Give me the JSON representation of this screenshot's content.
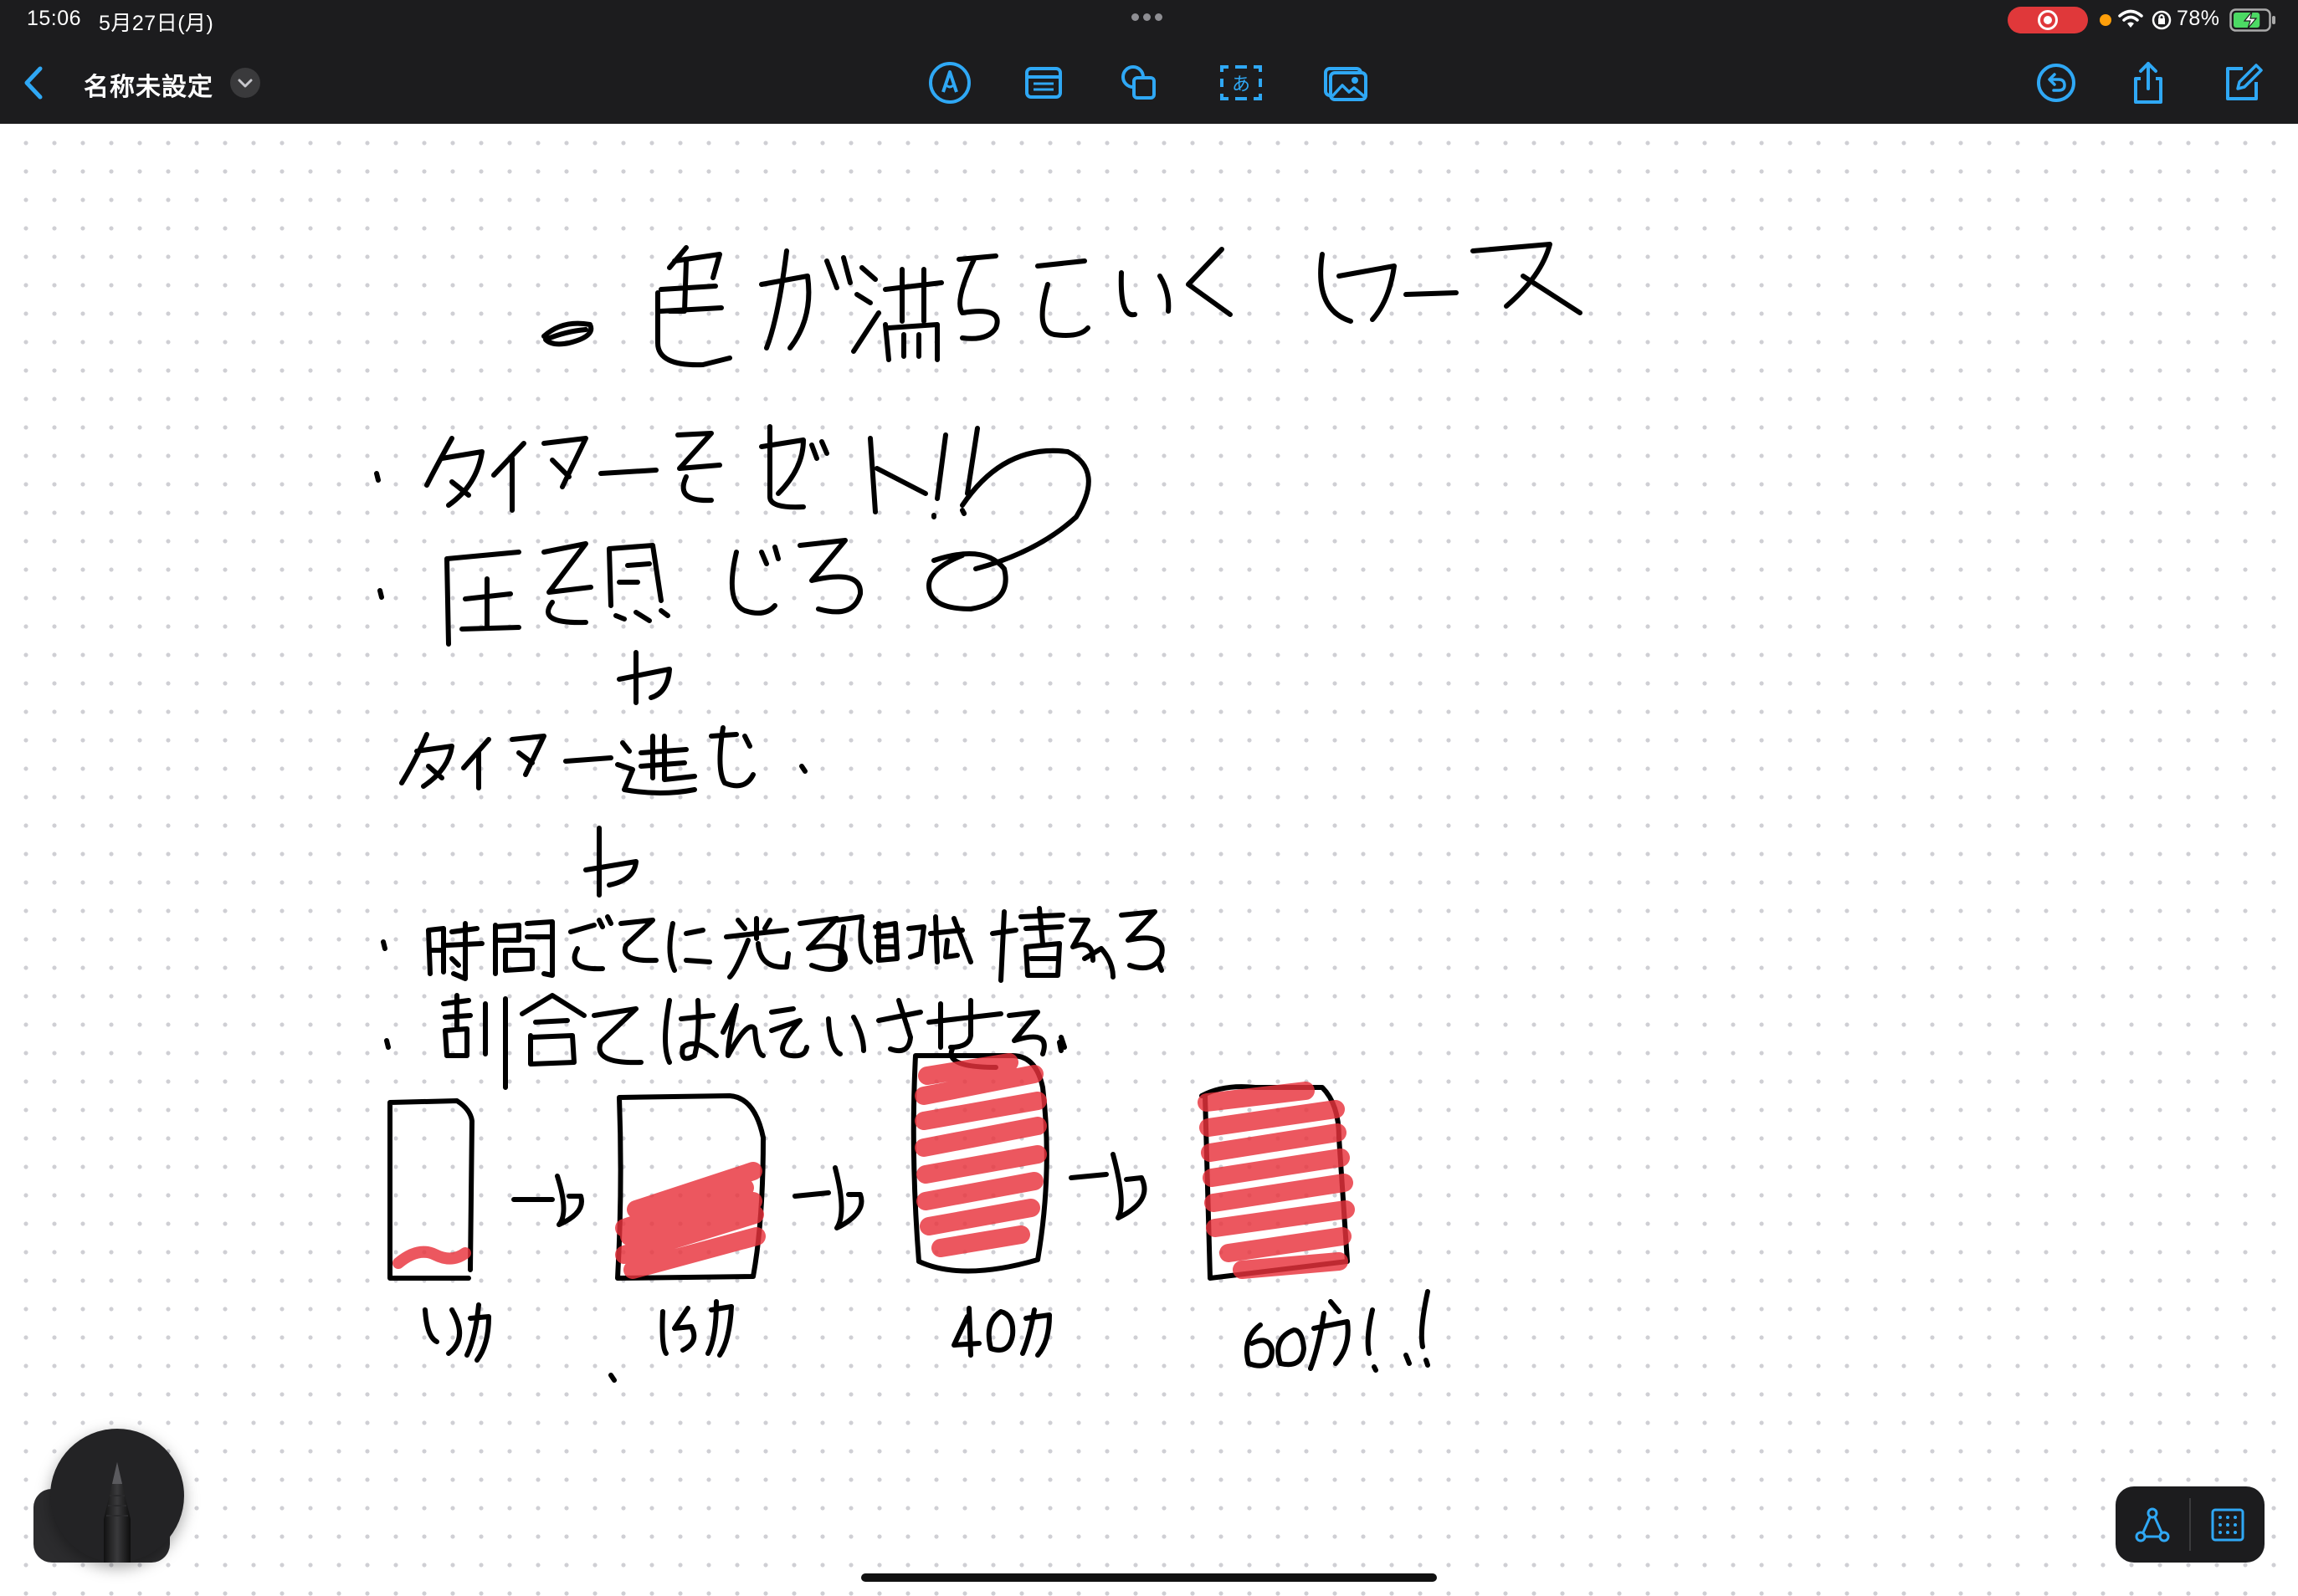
{
  "status_bar": {
    "time": "15:06",
    "date": "5月27日(月)",
    "battery_percent": "78%",
    "recording_active": true,
    "battery_level": 0.78,
    "accent_recording": "#e0383a",
    "accent_mic": "#ff9f0a",
    "battery_fill_color": "#4cd964"
  },
  "toolbar": {
    "document_title": "名称未設定",
    "accent_color": "#2fa8f5",
    "icons": {
      "back": "chevron-left-icon",
      "title_menu": "chevron-down-icon",
      "markup": "pen-circle-icon",
      "text_box": "text-box-icon",
      "shapes": "shapes-icon",
      "text_recognition": "text-recognition-icon",
      "media": "photo-icon",
      "undo": "undo-icon",
      "share": "share-icon",
      "new_board": "compose-icon"
    }
  },
  "canvas": {
    "background": "dot-grid",
    "ink_color": "#000000",
    "highlight_color": "#e8323c",
    "handwritten_text": [
      "色が満ちていくケース",
      "タイマーをセット!!",
      "圧を感じる",
      "タイマー進む",
      "時間ごとに光る領域増える",
      "割合をはんえいさせる"
    ],
    "progress_sketch": [
      {
        "label": "1分",
        "fill_fraction": 0.12
      },
      {
        "label": "15分",
        "fill_fraction": 0.45
      },
      {
        "label": "40分",
        "fill_fraction": 0.85
      },
      {
        "label": "60分!!",
        "fill_fraction": 1.0
      }
    ]
  },
  "bottom_tools": {
    "pen": "pencil-icon",
    "connect": "nodes-icon",
    "grid": "grid-icon"
  }
}
